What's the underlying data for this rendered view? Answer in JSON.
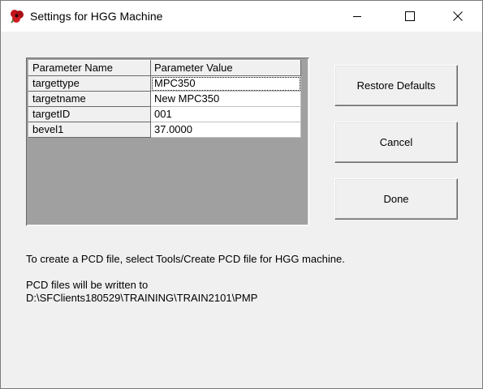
{
  "window": {
    "title": "Settings for HGG Machine",
    "icon": "red-poppy-app-icon",
    "controls": {
      "minimize": "minimize-icon",
      "maximize": "maximize-icon",
      "close": "close-icon"
    }
  },
  "grid": {
    "columns": [
      "Parameter Name",
      "Parameter Value"
    ],
    "rows": [
      {
        "name": "targettype",
        "value": "MPC350"
      },
      {
        "name": "targetname",
        "value": "New MPC350"
      },
      {
        "name": "targetID",
        "value": "001"
      },
      {
        "name": "bevel1",
        "value": "37.0000"
      }
    ]
  },
  "buttons": {
    "restore_defaults": "Restore Defaults",
    "cancel": "Cancel",
    "done": "Done"
  },
  "info": {
    "line1": "To create a PCD file, select Tools/Create PCD file for HGG machine.",
    "line2": "PCD files will be written to",
    "line3": "D:\\SFClients180529\\TRAINING\\TRAIN2101\\PMP"
  },
  "colors": {
    "grid_background": "#a0a0a0",
    "window_background": "#f0f0f0",
    "icon_red": "#c0161c"
  }
}
